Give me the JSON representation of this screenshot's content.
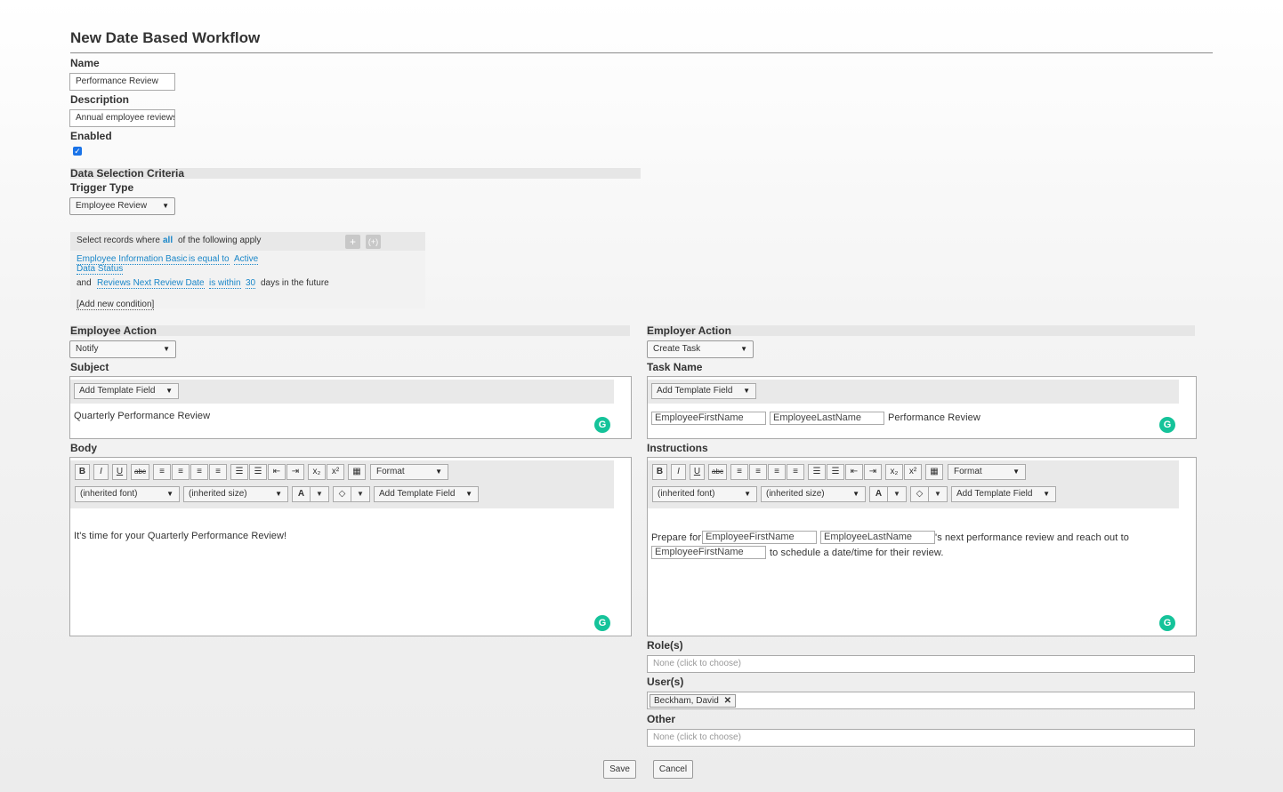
{
  "page": {
    "title": "New Date Based Workflow"
  },
  "form": {
    "name_label": "Name",
    "name_value": "Performance Review",
    "description_label": "Description",
    "description_value": "Annual employee reviews",
    "enabled_label": "Enabled",
    "enabled_checked": true,
    "enabled_check_glyph": "✓"
  },
  "criteria": {
    "section_label": "Data Selection Criteria",
    "trigger_label": "Trigger Type",
    "trigger_value": "Employee Review",
    "select_prefix": "Select records where",
    "all_link": "all",
    "select_suffix": "of the following apply",
    "add_icon": "+",
    "group_icon": "(+)",
    "cond1_field_line1": "Employee Information Basic",
    "cond1_field_line2": "Data Status",
    "cond1_operator": "is equal to",
    "cond1_value": "Active",
    "cond2_joiner": "and",
    "cond2_field": "Reviews Next Review Date",
    "cond2_operator": "is within",
    "cond2_value": "30",
    "cond2_suffix": "days in the future",
    "add_condition": "[Add new condition]"
  },
  "employee_action": {
    "section_label": "Employee Action",
    "action_value": "Notify",
    "subject_label": "Subject",
    "template_field_label": "Add Template Field",
    "subject_text": "Quarterly Performance Review",
    "body_label": "Body",
    "format_label": "Format",
    "font_value": "(inherited font)",
    "size_value": "(inherited size)",
    "body_text": "It's time for your Quarterly Performance Review!"
  },
  "employer_action": {
    "section_label": "Employer Action",
    "action_value": "Create Task",
    "task_name_label": "Task Name",
    "template_field_label": "Add Template Field",
    "task_field1": "EmployeeFirstName",
    "task_field2": "EmployeeLastName",
    "task_suffix": "Performance Review",
    "instructions_label": "Instructions",
    "format_label": "Format",
    "font_value": "(inherited font)",
    "size_value": "(inherited size)",
    "instr_prefix": "Prepare for",
    "instr_field1": "EmployeeFirstName",
    "instr_field2": "EmployeeLastName",
    "instr_mid": "'s next performance review and reach out to",
    "instr_field3": "EmployeeFirstName",
    "instr_suffix": "to schedule a date/time for their review.",
    "roles_label": "Role(s)",
    "roles_placeholder": "None  (click to choose)",
    "users_label": "User(s)",
    "user_chip": "Beckham, David",
    "user_remove_glyph": "✕",
    "other_label": "Other",
    "other_placeholder": "None  (click to choose)"
  },
  "toolbar_glyphs": {
    "bold": "B",
    "italic": "I",
    "underline": "U",
    "strike": "abc",
    "align_left": "≡",
    "align_center": "≡",
    "align_right": "≡",
    "justify": "≡",
    "bullets": "☰",
    "numbers": "☰",
    "outdent": "⇤",
    "indent": "⇥",
    "subscript": "x₂",
    "superscript": "x²",
    "table": "▦",
    "font_color": "A",
    "highlight": "◇",
    "caret": "▼",
    "grammarly": "G"
  },
  "actions": {
    "save": "Save",
    "cancel": "Cancel"
  },
  "colors": {
    "link": "#1a87c9",
    "grammarly": "#15c39a",
    "checkbox": "#1a73e8"
  }
}
